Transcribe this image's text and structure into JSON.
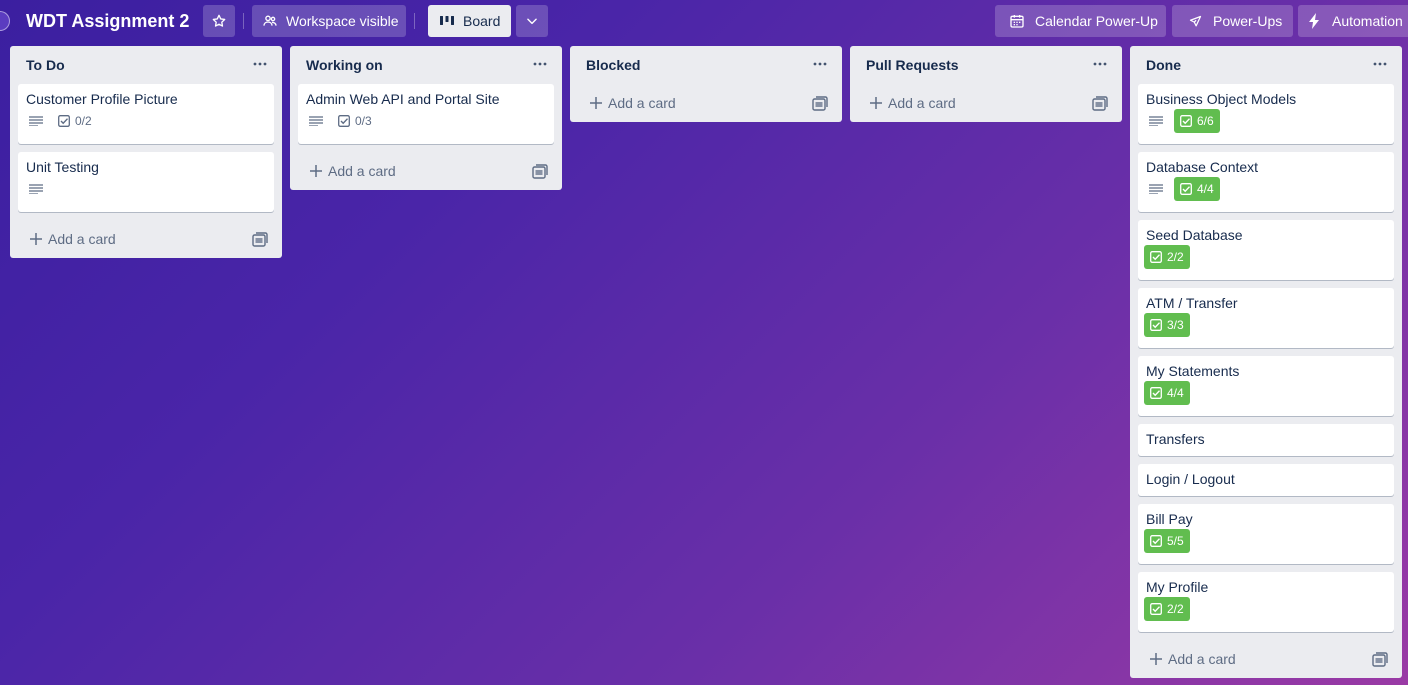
{
  "header": {
    "board_title": "WDT Assignment 2",
    "visibility_label": "Workspace visible",
    "view_label": "Board",
    "calendar_label": "Calendar Power-Up",
    "powerups_label": "Power-Ups",
    "automation_label": "Automation"
  },
  "colors": {
    "checklist_complete": "#61bd4f",
    "list_background": "#ebecf0",
    "board_gradient_start": "#3b1fa0",
    "board_gradient_end": "#9a3aa5"
  },
  "add_card_label": "Add a card",
  "lists": [
    {
      "title": "To Do",
      "cards": [
        {
          "title": "Customer Profile Picture",
          "has_description": true,
          "checklist": "0/2",
          "complete": false
        },
        {
          "title": "Unit Testing",
          "has_description": true,
          "checklist": null,
          "complete": false
        }
      ]
    },
    {
      "title": "Working on",
      "cards": [
        {
          "title": "Admin Web API and Portal Site",
          "has_description": true,
          "checklist": "0/3",
          "complete": false
        }
      ]
    },
    {
      "title": "Blocked",
      "cards": []
    },
    {
      "title": "Pull Requests",
      "cards": []
    },
    {
      "title": "Done",
      "cards": [
        {
          "title": "Business Object Models",
          "has_description": true,
          "checklist": "6/6",
          "complete": true
        },
        {
          "title": "Database Context",
          "has_description": true,
          "checklist": "4/4",
          "complete": true
        },
        {
          "title": "Seed Database",
          "has_description": false,
          "checklist": "2/2",
          "complete": true
        },
        {
          "title": "ATM / Transfer",
          "has_description": false,
          "checklist": "3/3",
          "complete": true
        },
        {
          "title": "My Statements",
          "has_description": false,
          "checklist": "4/4",
          "complete": true
        },
        {
          "title": "Transfers",
          "has_description": false,
          "checklist": null,
          "complete": false
        },
        {
          "title": "Login / Logout",
          "has_description": false,
          "checklist": null,
          "complete": false
        },
        {
          "title": "Bill Pay",
          "has_description": false,
          "checklist": "5/5",
          "complete": true
        },
        {
          "title": "My Profile",
          "has_description": false,
          "checklist": "2/2",
          "complete": true
        }
      ]
    }
  ]
}
